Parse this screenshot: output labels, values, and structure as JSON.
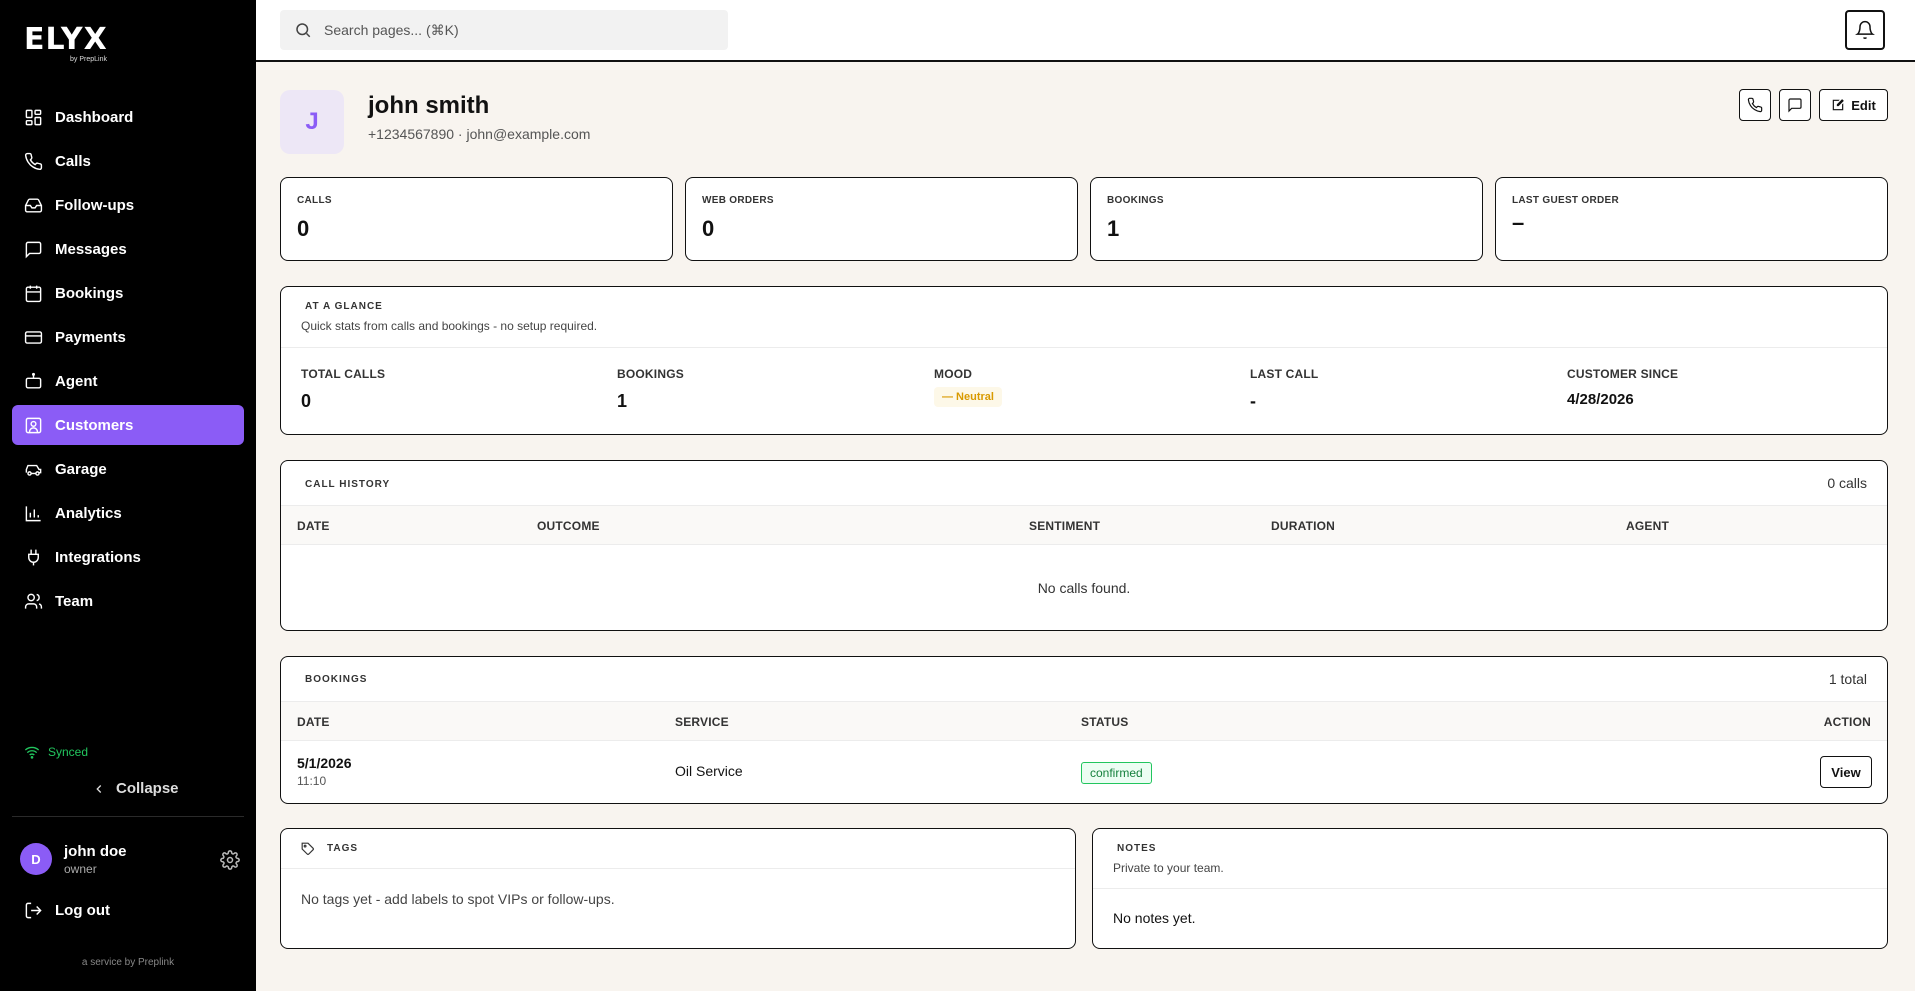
{
  "brand": {
    "logo": "ELYX",
    "sub": "by PrepLink"
  },
  "sidebar": {
    "items": [
      {
        "label": "Dashboard",
        "icon": "dashboard-icon"
      },
      {
        "label": "Calls",
        "icon": "phone-icon"
      },
      {
        "label": "Follow-ups",
        "icon": "inbox-icon"
      },
      {
        "label": "Messages",
        "icon": "message-icon"
      },
      {
        "label": "Bookings",
        "icon": "calendar-icon"
      },
      {
        "label": "Payments",
        "icon": "card-icon"
      },
      {
        "label": "Agent",
        "icon": "bot-icon"
      },
      {
        "label": "Customers",
        "icon": "contact-icon",
        "active": true
      },
      {
        "label": "Garage",
        "icon": "car-icon"
      },
      {
        "label": "Analytics",
        "icon": "chart-icon"
      },
      {
        "label": "Integrations",
        "icon": "plug-icon"
      },
      {
        "label": "Team",
        "icon": "users-icon"
      }
    ],
    "synced": "Synced",
    "collapse": "Collapse",
    "user": {
      "initial": "D",
      "name": "john doe",
      "role": "owner"
    },
    "logout": "Log out",
    "service": "a service by Preplink"
  },
  "topbar": {
    "search_placeholder": "Search pages... (⌘K)"
  },
  "customer": {
    "initial": "J",
    "name": "john smith",
    "contact": "+1234567890 · john@example.com",
    "edit_label": "Edit"
  },
  "stats": [
    {
      "label": "CALLS",
      "value": "0"
    },
    {
      "label": "WEB ORDERS",
      "value": "0"
    },
    {
      "label": "BOOKINGS",
      "value": "1"
    },
    {
      "label": "LAST GUEST ORDER",
      "value": "–"
    }
  ],
  "glance": {
    "title": "AT A GLANCE",
    "subtitle": "Quick stats from calls and bookings - no setup required.",
    "items": [
      {
        "label": "TOTAL CALLS",
        "value": "0"
      },
      {
        "label": "BOOKINGS",
        "value": "1"
      },
      {
        "label": "MOOD",
        "value": "— Neutral"
      },
      {
        "label": "LAST CALL",
        "value": "-"
      },
      {
        "label": "CUSTOMER SINCE",
        "value": "4/28/2026"
      }
    ]
  },
  "call_history": {
    "title": "CALL HISTORY",
    "count": "0 calls",
    "columns": [
      "DATE",
      "OUTCOME",
      "SENTIMENT",
      "DURATION",
      "AGENT"
    ],
    "empty": "No calls found."
  },
  "bookings": {
    "title": "BOOKINGS",
    "count": "1 total",
    "columns": [
      "DATE",
      "SERVICE",
      "STATUS",
      "ACTION"
    ],
    "rows": [
      {
        "date": "5/1/2026",
        "time": "11:10",
        "service": "Oil Service",
        "status": "confirmed",
        "action": "View"
      }
    ]
  },
  "tags": {
    "title": "TAGS",
    "empty": "No tags yet - add labels to spot VIPs or follow-ups."
  },
  "notes": {
    "title": "NOTES",
    "subtitle": "Private to your team.",
    "empty": "No notes yet."
  }
}
